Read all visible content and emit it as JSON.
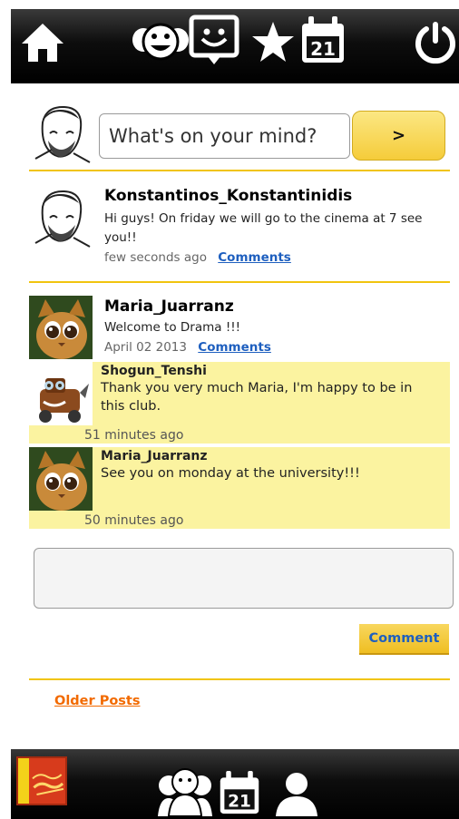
{
  "compose": {
    "placeholder": "What's on your mind?",
    "submit_label": ">"
  },
  "posts": [
    {
      "author": "Konstantinos_Konstantinidis",
      "text": "Hi guys! On friday we will go to the cinema at 7 see you!!",
      "time": "few seconds ago",
      "comments_link": "Comments"
    },
    {
      "author": "Maria_Juarranz",
      "text": "Welcome to Drama !!!",
      "time": "April 02 2013",
      "comments_link": "Comments",
      "comments": [
        {
          "author": "Shogun_Tenshi",
          "text": "Thank you very much Maria, I'm happy to be in this club.",
          "time": "51 minutes ago"
        },
        {
          "author": "Maria_Juarranz",
          "text": "See you on monday at the university!!!",
          "time": "50 minutes ago"
        }
      ]
    }
  ],
  "comment_form": {
    "value": "",
    "button_label": "Comment"
  },
  "pagination": {
    "older_label": "Older Posts"
  },
  "nav": {
    "top_icons": [
      "home-icon",
      "friends-icon",
      "messages-icon",
      "favorites-icon",
      "calendar-icon",
      "power-icon"
    ],
    "calendar_day": "21",
    "bottom_icons": [
      "club-logo",
      "group-icon",
      "calendar-icon",
      "profile-icon"
    ]
  },
  "colors": {
    "accent": "#f1c40f",
    "comment_bg": "#fbf3a0",
    "link": "#1e5fbf",
    "older_link": "#f26a00"
  }
}
